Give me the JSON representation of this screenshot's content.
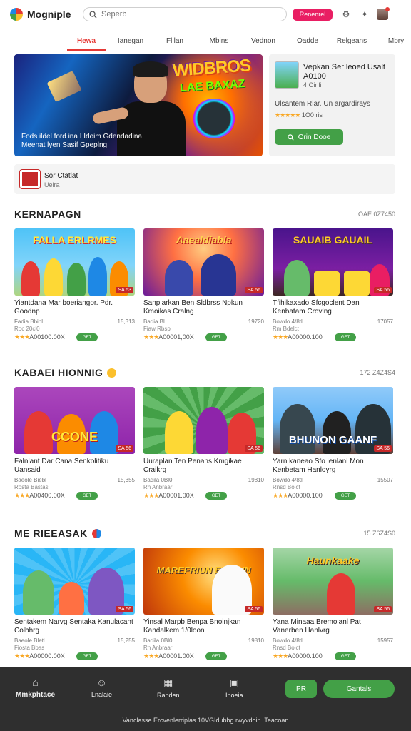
{
  "app": {
    "name": "Mogniple"
  },
  "search": {
    "placeholder": "Seperb"
  },
  "header": {
    "pink_button": "Renenrel"
  },
  "nav": {
    "tabs": [
      "Hewa",
      "Ianegan",
      "Flilan",
      "Mbins",
      "Vednon",
      "Oadde",
      "Relgeans",
      "Mbry"
    ]
  },
  "hero": {
    "logo_line1": "WIDBROS",
    "logo_line2": "LAE BAXAZ",
    "caption_line1": "Fods ildel ford ina I  Idoim Gdendadina",
    "caption_line2": "Meenat lyen Sasif Gpeplng"
  },
  "side": {
    "title": "Vepkan Ser leoed Usalt A0100",
    "subtitle": "4 Oinli",
    "desc": "Ulsantem Riar. Un argardirays",
    "rating_text": "1O0 ris",
    "button_label": "Orin Dooe"
  },
  "promo": {
    "title": "Sor Ctatlat",
    "sub": "Ueira"
  },
  "sections": [
    {
      "title": "KERNAPAGN",
      "meta": "OAE 0Z7450",
      "cards": [
        {
          "thumb_label": "FALLA ERLRMES",
          "tag": "SA 53",
          "title": "Yiantdana Mar boeriangor. Pdr. Goodnp",
          "sub": "Fadia Bbinl",
          "sub2": "Roc 20cl0",
          "stat": "15,313",
          "price": "A00100.00X",
          "get": "GET"
        },
        {
          "thumb_label": "Aaealdiabla",
          "tag": "SA 56",
          "title": "Sanplarkan Ben Sldbrss Npkun Kmoikas Cralng",
          "sub": "Badia Bl",
          "sub2": "Fiaw Rbsp",
          "stat": "19720",
          "price": "A00001,00X",
          "get": "GET"
        },
        {
          "thumb_label": "SAUAIB GAUAIL",
          "tag": "SA 56",
          "title": "Tfihikaxado Sfcgoclent Dan Kenbatam Crovlng",
          "sub": "Bowdo 4/8tl",
          "sub2": "Rm Bdelct",
          "stat": "17057",
          "price": "A00000.100",
          "get": "GET"
        }
      ]
    },
    {
      "title": "KABAEI HIONNIG",
      "meta": "172 Z4Z4S4",
      "cards": [
        {
          "thumb_label": "CCONE",
          "tag": "SA 56",
          "title": "Falnlant Dar Cana Senkolitiku Uansaid",
          "sub": "Baeole Biebl",
          "sub2": "Rosta Bastas",
          "stat": "15,355",
          "price": "A00400.00X",
          "get": "GET"
        },
        {
          "thumb_label": "",
          "tag": "SA 56",
          "title": "Uuraplan Ten Penans Kmgikae Craikrg",
          "sub": "Badila 0Bl0",
          "sub2": "Rn Anbraar",
          "stat": "19810",
          "price": "A00001.00X",
          "get": "GET"
        },
        {
          "thumb_label": "BHUNON GAANF",
          "tag": "SA 56",
          "title": "Yarn kaneao Sfo ienlanl Mon Kenbetam Hanloyrg",
          "sub": "Bowdo 4/8tl",
          "sub2": "Rnsd Bolct",
          "stat": "15507",
          "price": "A00000.100",
          "get": "GET"
        }
      ]
    },
    {
      "title": "ME RIEEASAK",
      "meta": "15 Z6Z4S0",
      "cards": [
        {
          "thumb_label": "",
          "tag": "SA 56",
          "title": "Sentakem Narvg Sentaka Kanulacant Colbhrg",
          "sub": "Baeole Bletl",
          "sub2": "Fiosta Bbas",
          "stat": "15,255",
          "price": "A00000.00X",
          "get": "GET"
        },
        {
          "thumb_label": "MAREFRIUN ERGAIN",
          "tag": "SA 56",
          "title": "Yinsal Marpb Benpa Bnoinjkan Kandalkem 1/0loon",
          "sub": "Badila 0Bl0",
          "sub2": "Rn Anbraar",
          "stat": "19810",
          "price": "A00001.00X",
          "get": "GET"
        },
        {
          "thumb_label": "Haunkaake",
          "tag": "SA 56",
          "title": "Yana Minaaa Bremolanl Pat Vanerben Hanlvrg",
          "sub": "Bowdo 4/8tl",
          "sub2": "Rnsd Bolct",
          "stat": "15957",
          "price": "A00000.100",
          "get": "GET"
        }
      ]
    }
  ],
  "bottom": {
    "nav": [
      "Mmkphtace",
      "Lnalaie",
      "Randen",
      "Inoeia"
    ],
    "small_button": "PR",
    "big_button": "Gantals",
    "footer": "Vanclasse Ercvenlerriplas 10VGIdubbg rwyvdoin. Teacoan"
  },
  "colors": {
    "accent": "#e53935",
    "green": "#43a047",
    "pink": "#e91e63",
    "bottom_bg": "#2f2f2f"
  }
}
